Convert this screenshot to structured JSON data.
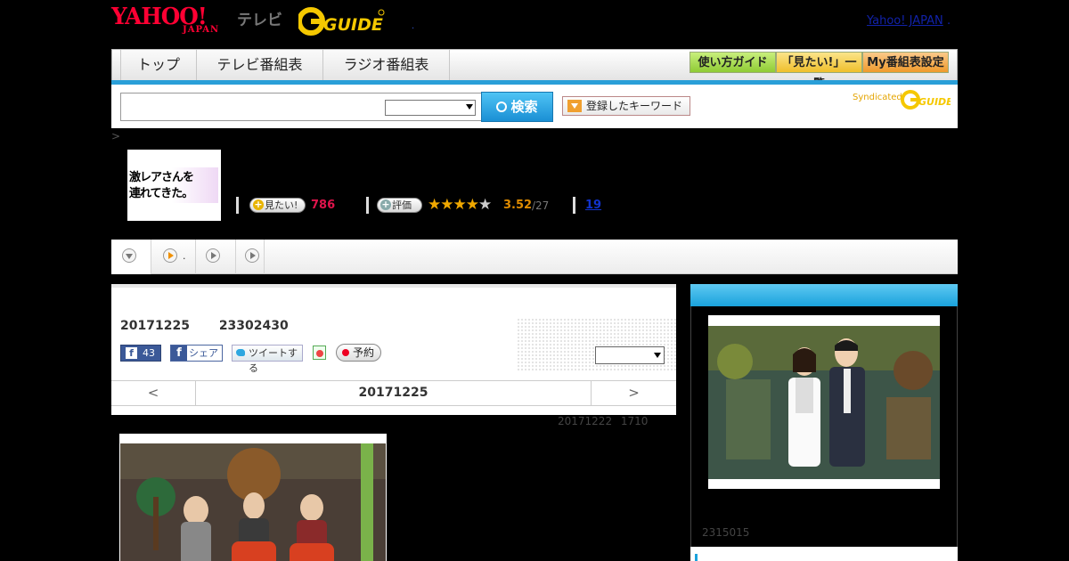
{
  "header": {
    "yahoo_logo": "YAHOO!",
    "yahoo_logo_sub": "JAPAN",
    "tv_label": "テレビ",
    "gguide_logo": "GUIDE",
    "top_link": "Yahoo! JAPAN",
    "top_link_tail": ".",
    "small_dot": "."
  },
  "nav": {
    "tabs": [
      {
        "label": "トップ"
      },
      {
        "label": "テレビ番組表"
      },
      {
        "label": "ラジオ番組表"
      }
    ],
    "utility_buttons": [
      {
        "label": "使い方ガイド",
        "color": "#9fd64a"
      },
      {
        "label": "「見たい!」一覧",
        "color": "#f2c94a"
      },
      {
        "label": "My番組表設定",
        "color": "#f2a64a"
      }
    ]
  },
  "search": {
    "input_value": "",
    "select_value": "",
    "button_label": "検索",
    "keyword_button_label": "登録したキーワード",
    "syndicated_label": "Syndicated",
    "syndicated_logo": "GUIDE"
  },
  "breadcrumb": ">",
  "program": {
    "thumbnail_text_line1": "激レアさんを",
    "thumbnail_text_line2": "連れてきた。",
    "want_button": "見たい!",
    "want_count": "786",
    "rate_button": "評価",
    "rating_value": "3.52",
    "rating_count": "/27",
    "review_count": "19",
    "rating_stars": 3.5
  },
  "program_tabs": [
    {
      "icon": "chevron-down-icon",
      "label": ""
    },
    {
      "icon": "play-icon",
      "label": "."
    },
    {
      "icon": "play-icon",
      "label": ""
    },
    {
      "icon": "play-icon",
      "label": ""
    }
  ],
  "episode": {
    "date": "20171225",
    "time": "23302430",
    "fb_like_count": "43",
    "fb_share_label": "シェア",
    "tweet_label": "ツイートする",
    "record_label": "予約",
    "select_value": "",
    "nav_prev": "<",
    "nav_date": "20171225",
    "nav_next": ">",
    "updated": "20171222 1710"
  },
  "sidebar": {
    "caption": "2315015"
  },
  "colors": {
    "accent_blue": "#1aa2dc",
    "yahoo_red": "#ff0033",
    "gguide_yellow": "#f5c800",
    "want_red": "#e0144c",
    "rating_orange": "#e08c00"
  }
}
